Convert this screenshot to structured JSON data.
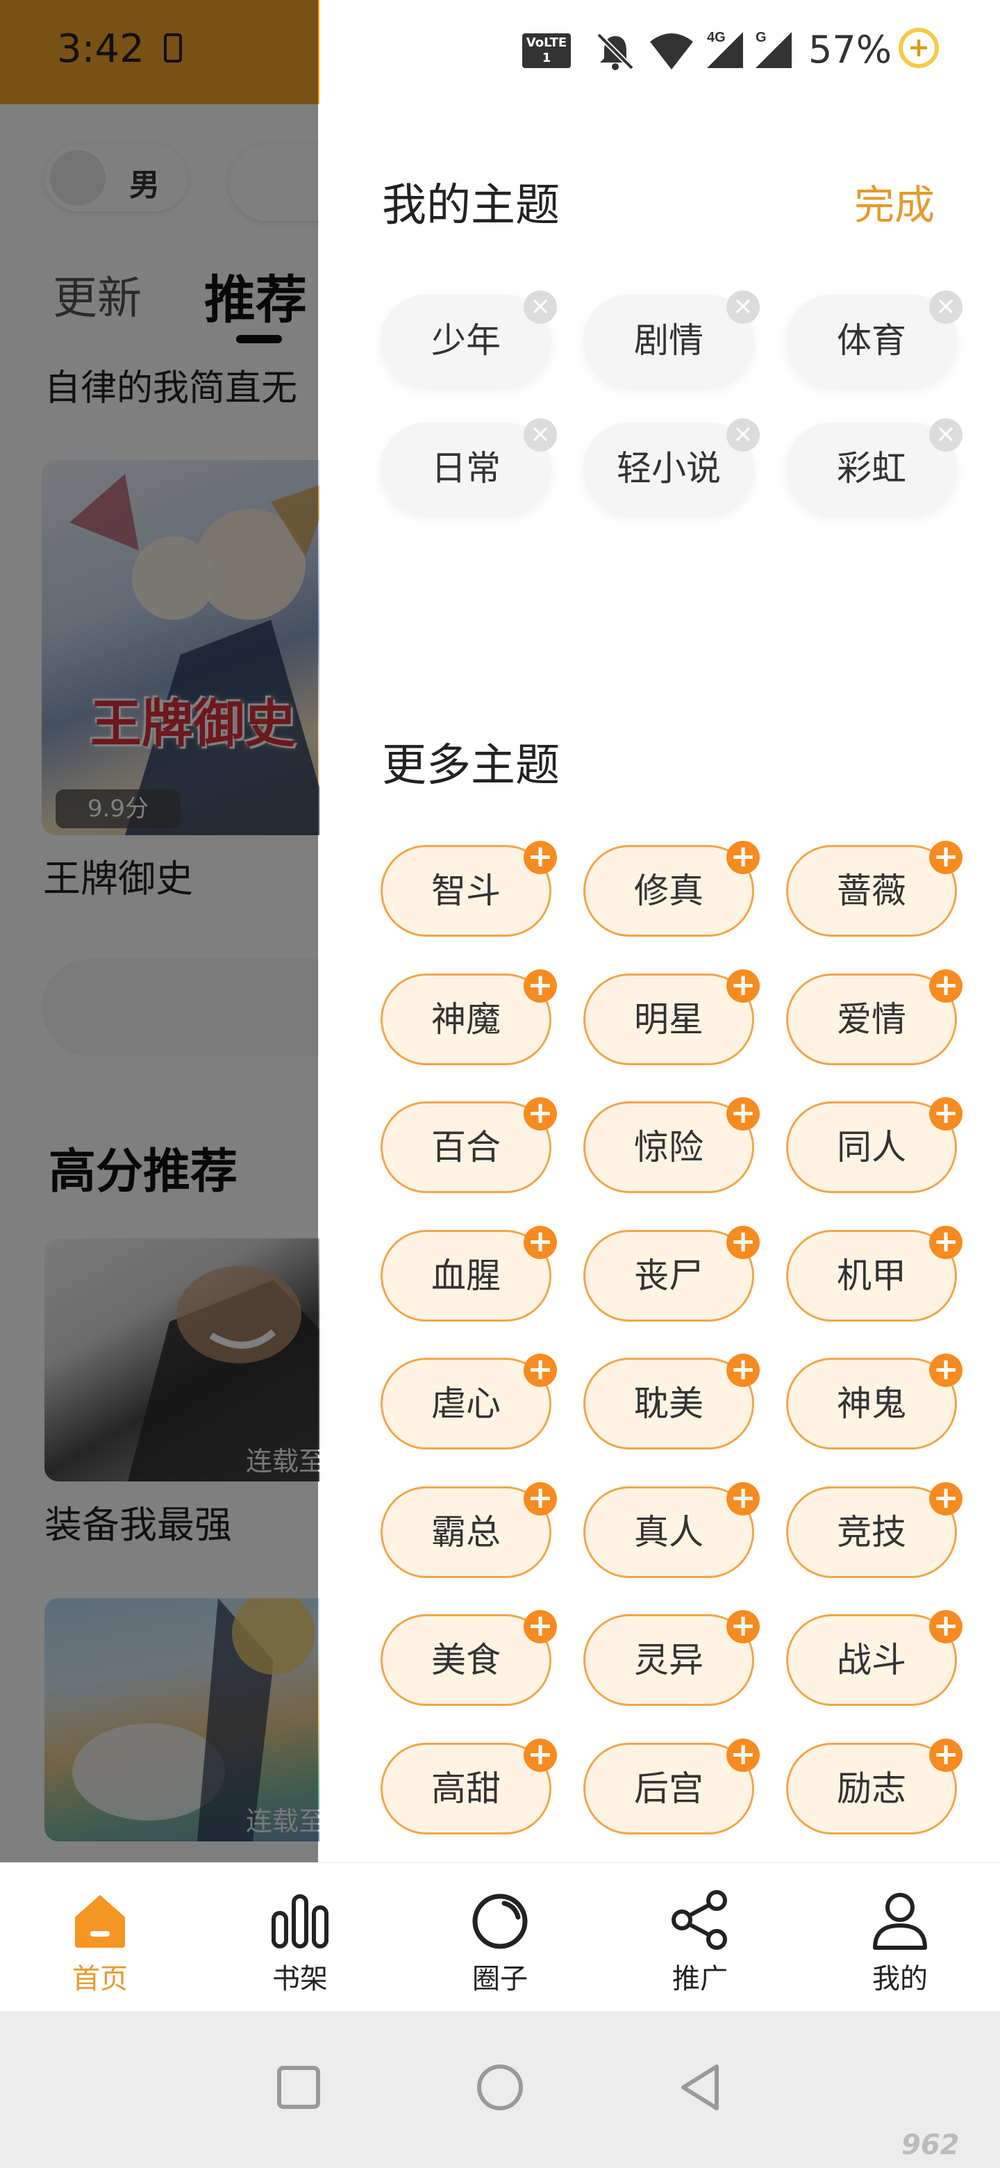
{
  "status_bar": {
    "time": "3:42",
    "volte_line1": "VoLTE",
    "volte_line2": "1",
    "network_4g": "4G",
    "network_g": "G",
    "battery": "57%",
    "battery_icon": "+"
  },
  "background_app": {
    "gender_toggle_label": "男",
    "tabs": [
      "更新",
      "推荐"
    ],
    "slogan": "自律的我简直无",
    "featured": {
      "title_art": "王牌御史",
      "score": "9.9分",
      "name": "王牌御史"
    },
    "section_title": "高分推荐",
    "items": [
      {
        "status": "连载至",
        "name": "装备我最强"
      },
      {
        "status": "连载至",
        "name": ""
      }
    ]
  },
  "theme_panel": {
    "title": "我的主题",
    "done_label": "完成",
    "remove_symbol": "×",
    "my_themes": [
      "少年",
      "剧情",
      "体育",
      "日常",
      "轻小说",
      "彩虹"
    ],
    "more_title": "更多主题",
    "add_symbol": "+",
    "more_themes": [
      "智斗",
      "修真",
      "蔷薇",
      "神魔",
      "明星",
      "爱情",
      "百合",
      "惊险",
      "同人",
      "血腥",
      "丧尸",
      "机甲",
      "虐心",
      "耽美",
      "神鬼",
      "霸总",
      "真人",
      "竞技",
      "美食",
      "灵异",
      "战斗",
      "高甜",
      "后宫",
      "励志"
    ]
  },
  "bottom_nav": {
    "items": [
      {
        "label": "首页",
        "icon": "home-icon",
        "active": true
      },
      {
        "label": "书架",
        "icon": "bookshelf-icon",
        "active": false
      },
      {
        "label": "圈子",
        "icon": "circle-icon",
        "active": false
      },
      {
        "label": "推广",
        "icon": "share-icon",
        "active": false
      },
      {
        "label": "我的",
        "icon": "profile-icon",
        "active": false
      }
    ]
  },
  "system_nav": [
    "recent-apps-icon",
    "home-circle-icon",
    "back-icon"
  ],
  "watermark": "962",
  "colors": {
    "accent": "#e59a2a",
    "chip_orange": "#f78b1f",
    "chip_bg": "#fff3e4"
  }
}
